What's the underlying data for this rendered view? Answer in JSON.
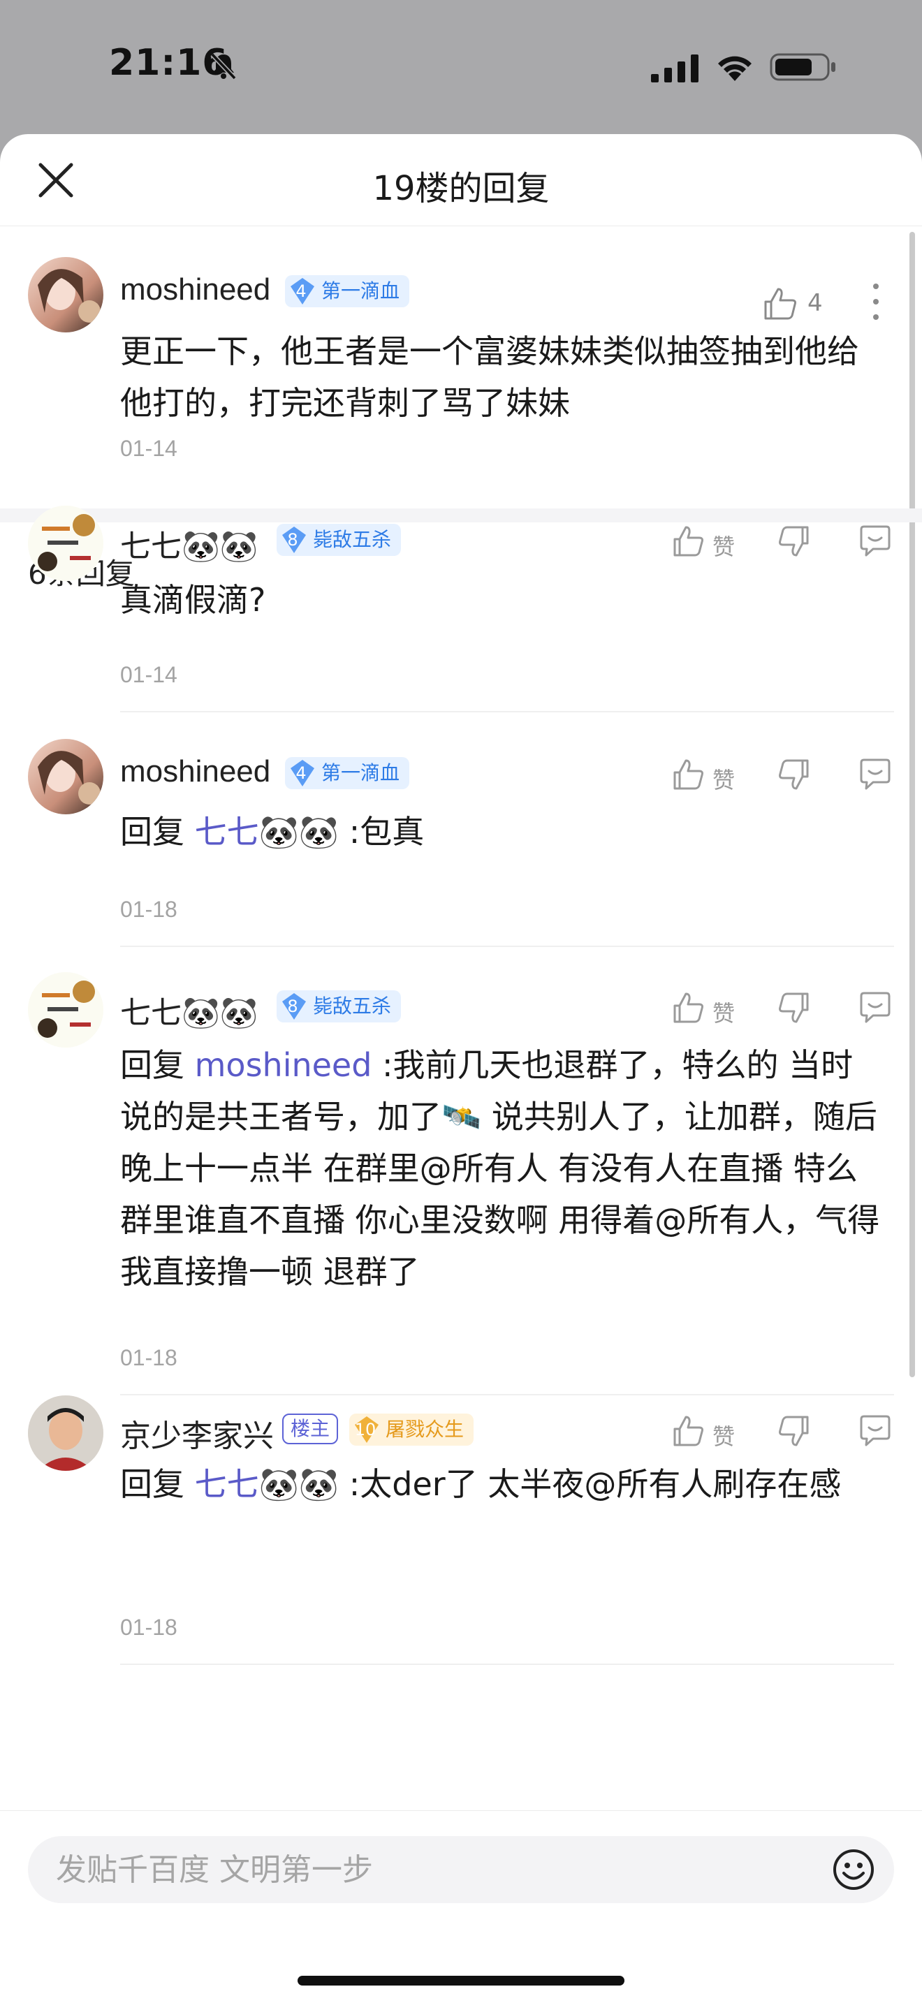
{
  "status_bar": {
    "time": "21:16"
  },
  "header": {
    "title": "19楼的回复"
  },
  "main_post": {
    "username": "moshineed",
    "level": "4",
    "badge": "第一滴血",
    "likes": "4",
    "content": "更正一下，他王者是一个富婆妹妹类似抽签抽到他给他打的，打完还背刺了骂了妹妹",
    "date": "01-14"
  },
  "reply_count": "6条回复",
  "replies": [
    {
      "username": "七七🐼🐼",
      "level": "8",
      "badge": "毙敌五杀",
      "prefix": "",
      "mention": "",
      "content": "真滴假滴?",
      "date": "01-14",
      "like_label": "赞"
    },
    {
      "username": "moshineed",
      "level": "4",
      "badge": "第一滴血",
      "prefix": "回复 ",
      "mention": "七七🐼🐼",
      "content": " :包真",
      "date": "01-18",
      "like_label": "赞"
    },
    {
      "username": "七七🐼🐼",
      "level": "8",
      "badge": "毙敌五杀",
      "prefix": "回复 ",
      "mention": "moshineed",
      "content": " :我前几天也退群了，特么的 当时说的是共王者号，加了🛰️ 说共别人了，让加群，随后晚上十一点半 在群里@所有人 有没有人在直播 特么 群里谁直不直播 你心里没数啊 用得着@所有人，气得我直接撸一顿 退群了",
      "date": "01-18",
      "like_label": "赞"
    },
    {
      "username": "京少李家兴",
      "op_badge": "楼主",
      "level": "10",
      "badge": "屠戮众生",
      "prefix": "回复 ",
      "mention": "七七🐼🐼",
      "content": " :太der了 太半夜@所有人刷存在感",
      "date": "01-18",
      "like_label": "赞"
    }
  ],
  "input": {
    "placeholder": "发贴千百度 文明第一步"
  },
  "colors": {
    "accent": "#5a5ac8",
    "badge_blue": "#2d7be6",
    "badge_gold": "#e59a1c"
  }
}
